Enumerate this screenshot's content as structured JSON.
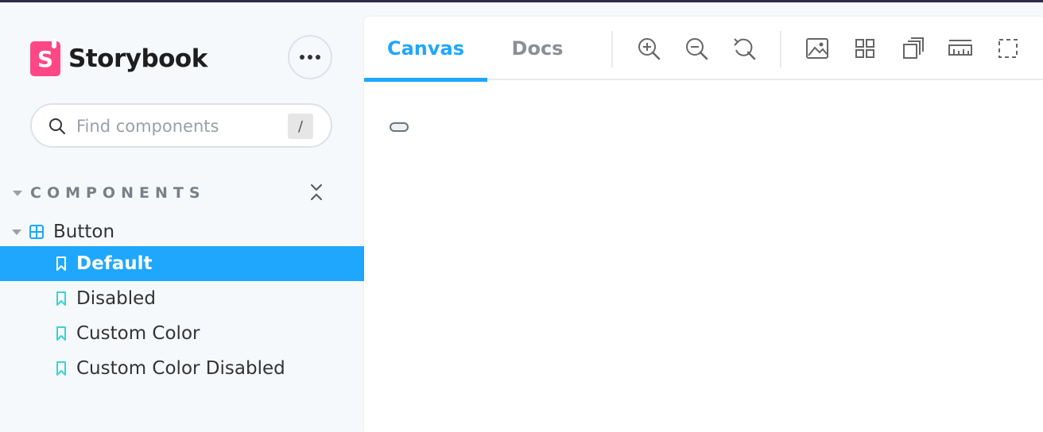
{
  "brand": {
    "name": "Storybook",
    "logo_letter": "S"
  },
  "sidebar": {
    "menu_icon": "ellipsis-icon",
    "search": {
      "placeholder": "Find components",
      "shortcut": "/"
    },
    "section_label": "COMPONENTS",
    "component": {
      "label": "Button",
      "icon": "component-grid-icon"
    },
    "stories": [
      {
        "label": "Default",
        "active": true
      },
      {
        "label": "Disabled",
        "active": false
      },
      {
        "label": "Custom Color",
        "active": false
      },
      {
        "label": "Custom Color Disabled",
        "active": false
      }
    ]
  },
  "toolbar": {
    "tabs": [
      {
        "label": "Canvas",
        "active": true
      },
      {
        "label": "Docs",
        "active": false
      }
    ],
    "tools": [
      "zoom-in-icon",
      "zoom-out-icon",
      "zoom-reset-icon",
      "background-icon",
      "grid-icon",
      "viewport-icon",
      "measure-icon",
      "outline-icon"
    ]
  },
  "colors": {
    "accent": "#1ea7fd",
    "brand": "#ff4785",
    "sidebar_bg": "#f6f9fc"
  }
}
